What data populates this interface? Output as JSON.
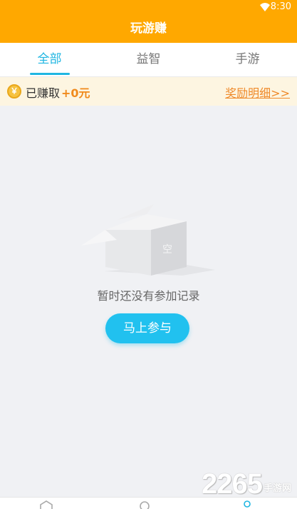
{
  "status_bar": {
    "time": "8:30",
    "wifi_icon": "wifi-icon"
  },
  "app_bar": {
    "title": "玩游赚"
  },
  "tabs": [
    {
      "label": "全部",
      "active": true
    },
    {
      "label": "益智",
      "active": false
    },
    {
      "label": "手游",
      "active": false
    }
  ],
  "earnings": {
    "coin_symbol": "￥",
    "label": "已赚取",
    "amount": "+0元",
    "reward_link": "奖励明细>>"
  },
  "empty_state": {
    "box_label": "空",
    "message": "暂时还没有参加记录",
    "button_label": "马上参与"
  },
  "watermark": {
    "number": "2265",
    "suffix": "手游网"
  },
  "colors": {
    "accent_orange": "#ffa800",
    "tab_active": "#1fb6e2",
    "button_blue": "#21c1ef",
    "amount_orange": "#f08a1c"
  }
}
